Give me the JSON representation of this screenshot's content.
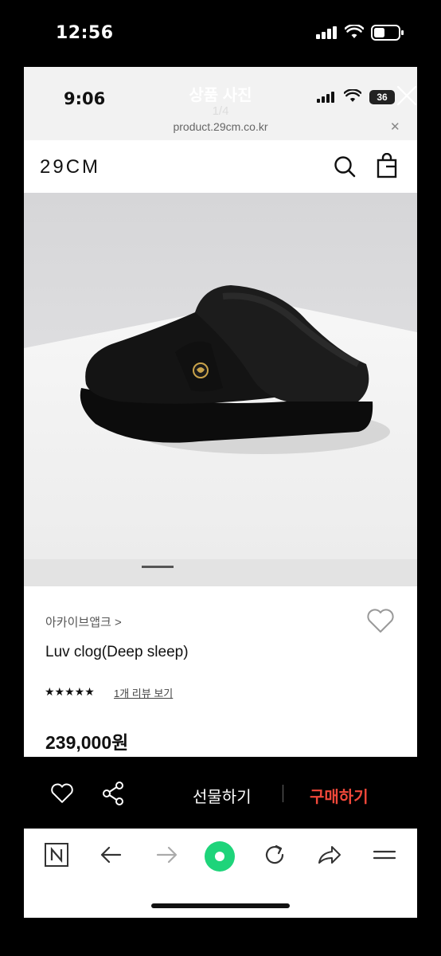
{
  "outer_status": {
    "time": "12:56"
  },
  "inner_status": {
    "time": "9:06",
    "battery": "36",
    "url": "product.29cm.co.kr"
  },
  "overlay": {
    "title": "상품 사진",
    "counter": "1/4"
  },
  "site": {
    "logo": "29CM"
  },
  "product": {
    "brand": "아카이브앱크 >",
    "name": "Luv clog(Deep sleep)",
    "rating_stars": "★★★★★",
    "review_link": "1개 리뷰 보기",
    "price": "239,000원"
  },
  "actions": {
    "gift_label": "선물하기",
    "buy_label": "구매하기"
  },
  "browser_toolbar": {
    "items": [
      "n-home-icon",
      "back-arrow-icon",
      "forward-arrow-icon",
      "green-dot-icon",
      "reload-icon",
      "share-arrow-icon",
      "menu-icon"
    ]
  },
  "colors": {
    "buy_accent": "#f0483a",
    "green_button": "#1ed47a"
  }
}
